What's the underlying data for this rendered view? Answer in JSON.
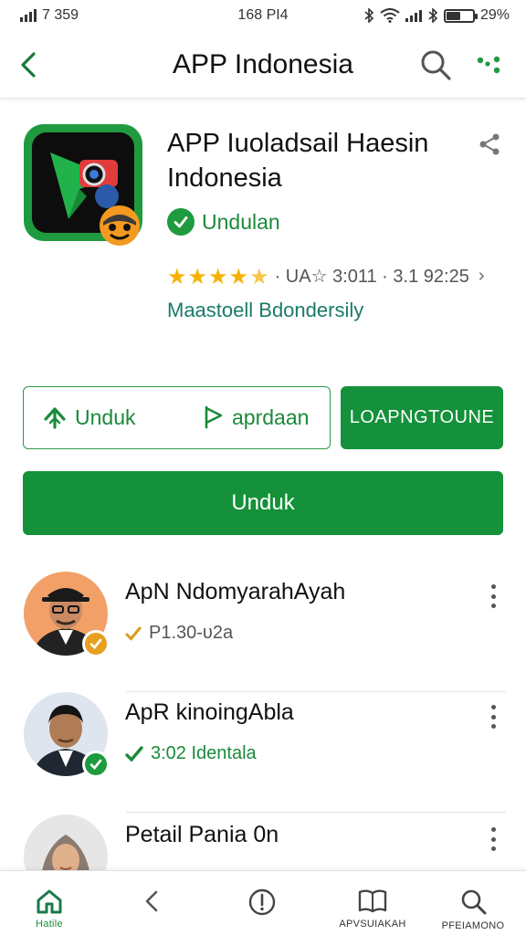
{
  "status_bar": {
    "left_text": "7 359",
    "center_time": "168 PI4",
    "battery_text": "29%",
    "battery_level_percent": 55
  },
  "app_bar": {
    "title": "APP Indonesia",
    "back_icon": "chevron-left-icon",
    "search_icon": "search-icon",
    "more_icon": "dots-menu-icon"
  },
  "app": {
    "title_line1": "APP Iuoladsail Haesin",
    "title_line2": "Indonesia",
    "verified_label": "Undulan",
    "rating_value": 4.5,
    "rating_text": "· UA☆ 3:011 · 3.1 92:25",
    "rating_arrow": "›",
    "developer": "Maastoell Bdondersily"
  },
  "actions": {
    "outline_primary": "Unduk",
    "outline_secondary": "aprdaan",
    "solid_small": "LOAPNGTOUNE",
    "primary": "Unduk"
  },
  "list": [
    {
      "name": "ApN NdomyarahAyah",
      "subtitle": "P1.30-υ2a",
      "sub_color": "#555555",
      "mark_color": "#d99a1a",
      "badge_color": "#e8a020"
    },
    {
      "name": "ApR kinoingAbla",
      "subtitle": "3:02 Identala",
      "sub_color": "#1a8a3a",
      "mark_color": "#1a8a3a",
      "badge_color": "#1f9a3f"
    },
    {
      "name": "Petail Pania 0n",
      "subtitle": "",
      "sub_color": "#555555",
      "mark_color": "#d99a1a",
      "badge_color": "#1f9a3f"
    }
  ],
  "bottom_nav": {
    "items": [
      {
        "label": "Hatile",
        "icon": "home-icon"
      },
      {
        "label": "",
        "icon": "back-icon"
      },
      {
        "label": "",
        "icon": "info-icon"
      },
      {
        "label": "APVSUIAKAH",
        "icon": "book-icon"
      },
      {
        "label": "PFEIAMONO",
        "icon": "search-icon"
      }
    ]
  },
  "colors": {
    "brand_green": "#14913a",
    "verified_green": "#1c8a3a",
    "star_gold": "#f5b301",
    "developer_teal": "#1a7a6a"
  }
}
